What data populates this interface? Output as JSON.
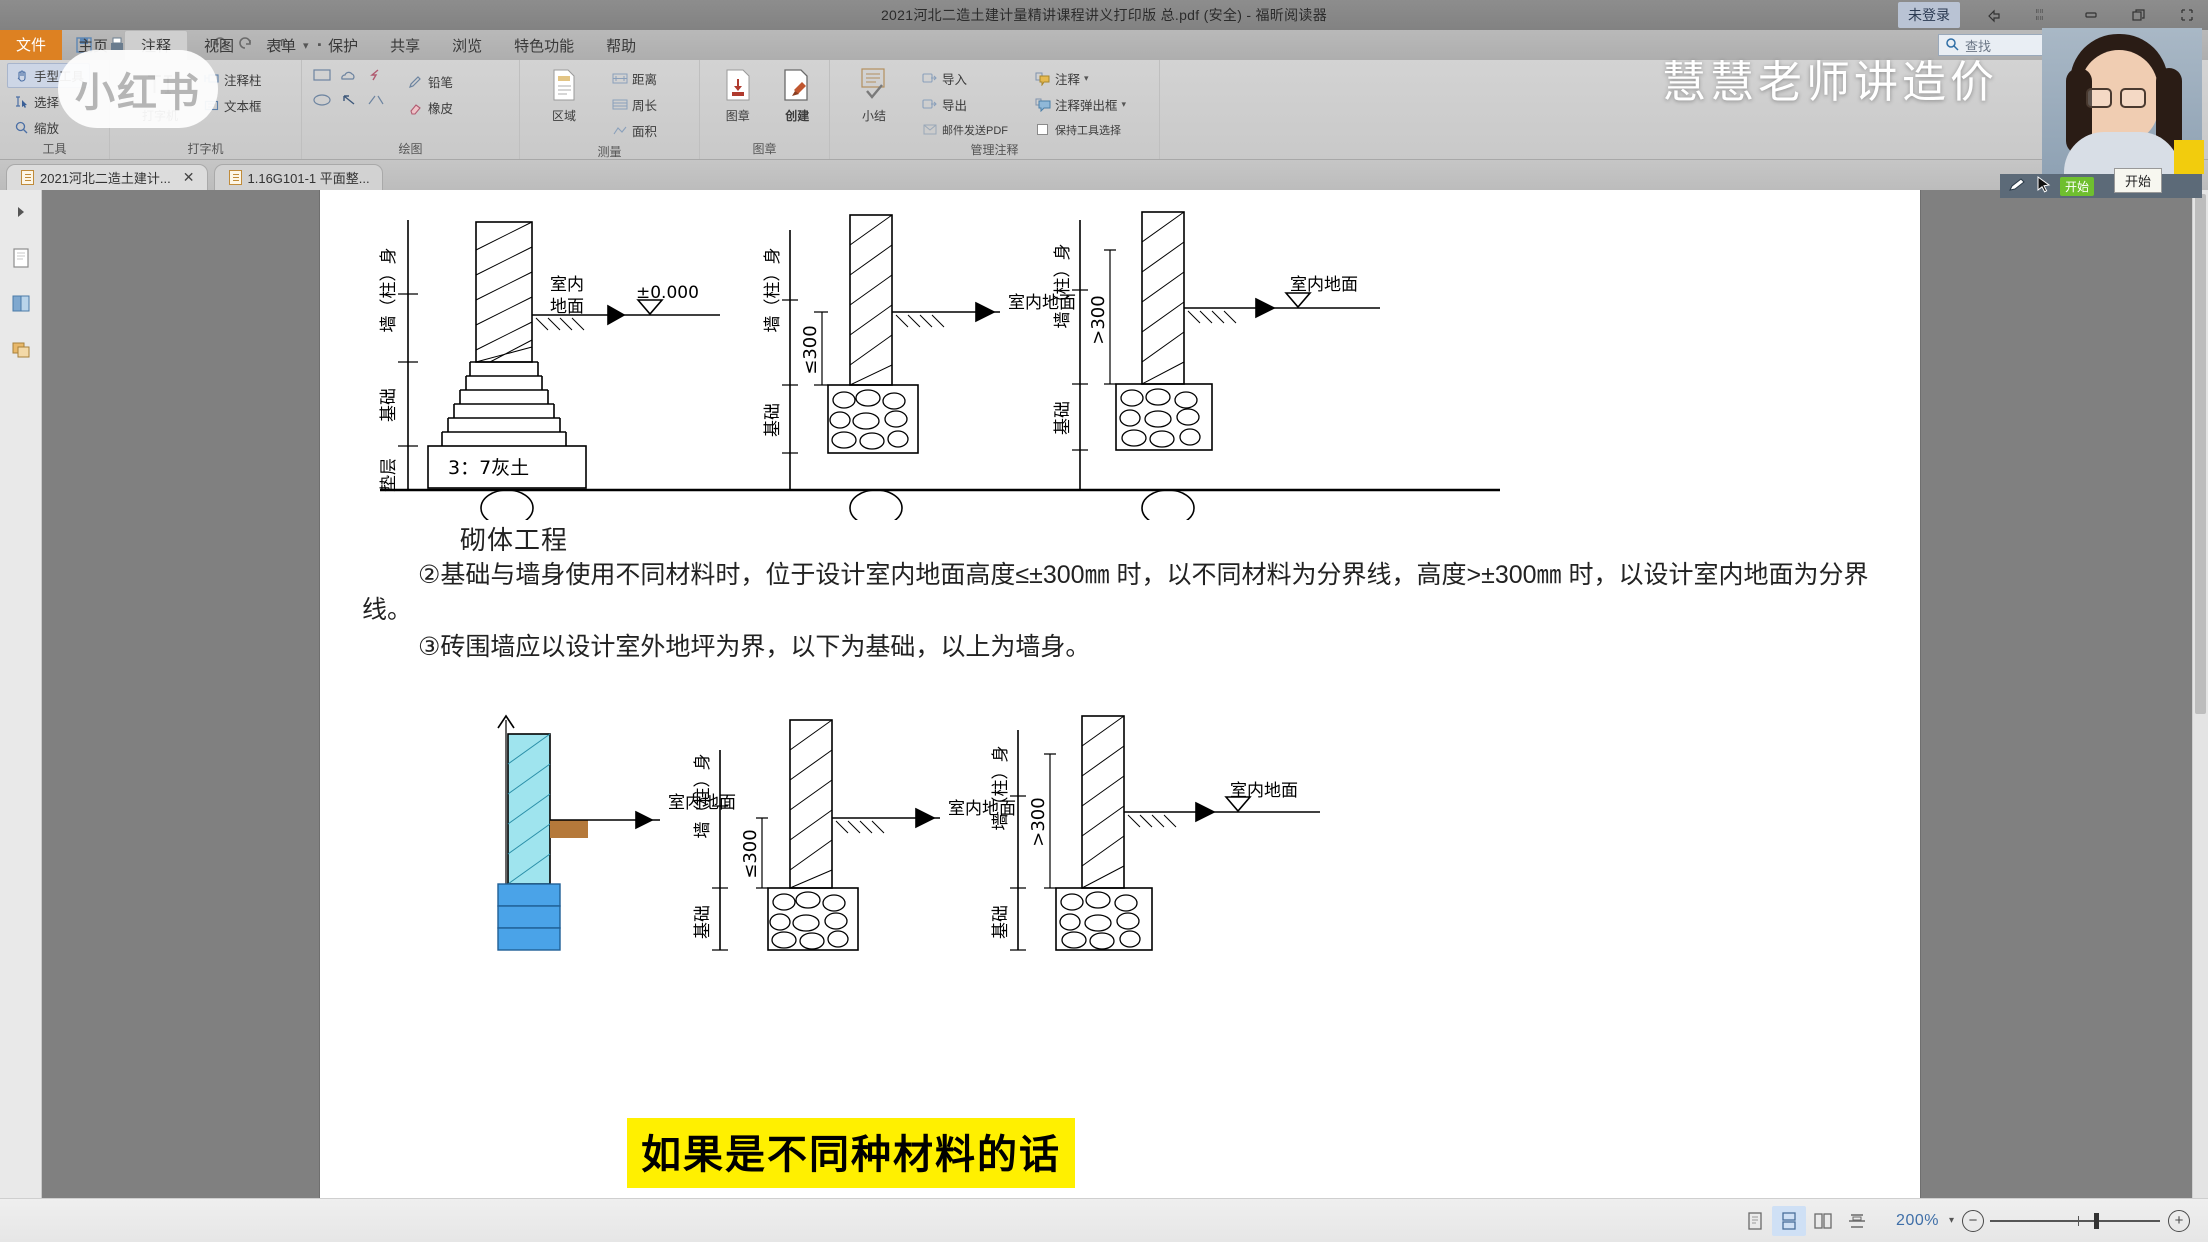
{
  "window": {
    "title": "2021河北二造土建计量精讲课程讲义打印版 总.pdf (安全) - 福昕阅读器",
    "account_label": "未登录",
    "buttons": {
      "share": "share-icon",
      "ribbon_display": "ribbon-options-icon",
      "minimize": "—",
      "restore": "❐",
      "close": "✕"
    }
  },
  "quick_access": {
    "items": [
      "new-document-icon",
      "open-folder-icon",
      "save-icon",
      "print-icon",
      "email-icon",
      "highlight-icon",
      "undo-icon",
      "redo-icon",
      "hand-tool-icon"
    ]
  },
  "search": {
    "placeholder": "查找",
    "icon": "search-icon"
  },
  "ribbon": {
    "file_tab": "文件",
    "tabs": [
      {
        "label": "主页",
        "active": false
      },
      {
        "label": "注释",
        "active": true
      },
      {
        "label": "视图",
        "active": false
      },
      {
        "label": "表单",
        "active": false
      },
      {
        "label": "保护",
        "active": false
      },
      {
        "label": "共享",
        "active": false
      },
      {
        "label": "浏览",
        "active": false
      },
      {
        "label": "特色功能",
        "active": false
      },
      {
        "label": "帮助",
        "active": false
      }
    ],
    "groups": [
      {
        "label": "工具",
        "items": [
          {
            "label": "手型工具",
            "icon": "hand-icon",
            "selected": true
          },
          {
            "label": "选择",
            "icon": "select-text-icon",
            "selected": false
          },
          {
            "label": "缩放",
            "icon": "zoom-icon",
            "selected": false
          }
        ]
      },
      {
        "label": "打字机",
        "items": [
          {
            "label": "打字机",
            "icon": "typewriter-icon"
          },
          {
            "label": "注释柱",
            "icon": "callout-icon"
          },
          {
            "label": "文本框",
            "icon": "textbox-icon"
          }
        ]
      },
      {
        "label": "绘图",
        "shapes": [
          "rectangle-icon",
          "cloud-icon",
          "polyline-icon",
          "ellipse-icon",
          "arrow-icon",
          "line-icon"
        ],
        "items": [
          {
            "label": "铅笔",
            "icon": "pencil-icon"
          },
          {
            "label": "橡皮",
            "icon": "eraser-icon"
          }
        ]
      },
      {
        "label": "测量",
        "items": [
          {
            "label": "区域",
            "icon": "area-measure-icon"
          },
          {
            "label": "距离",
            "icon": "distance-measure-icon"
          },
          {
            "label": "周长",
            "icon": "perimeter-measure-icon"
          },
          {
            "label": "面积",
            "icon": "surface-measure-icon"
          }
        ]
      },
      {
        "label": "图章",
        "items": [
          {
            "label": "图章",
            "icon": "stamp-icon"
          },
          {
            "label": "创建",
            "icon": "create-stamp-icon"
          }
        ]
      },
      {
        "label": "管理注释",
        "items": [
          {
            "label": "小结",
            "icon": "summary-icon"
          },
          {
            "label": "导入",
            "icon": "import-icon"
          },
          {
            "label": "导出",
            "icon": "export-icon"
          },
          {
            "label": "邮件发送PDF",
            "icon": "mail-pdf-icon"
          },
          {
            "label": "注释",
            "icon": "comment-icon"
          },
          {
            "label": "注释弹出框",
            "icon": "comment-popup-icon"
          },
          {
            "label": "保持工具选择",
            "icon": "keep-tool-icon"
          }
        ]
      }
    ]
  },
  "doc_tabs": [
    {
      "label": "2021河北二造土建计...",
      "active": true,
      "closable": true
    },
    {
      "label": "1.16G101-1 平面整...",
      "active": false,
      "closable": false
    }
  ],
  "left_rail": {
    "items": [
      "expand-panel-icon",
      "page-thumbnails-icon",
      "bookmarks-icon",
      "layers-icon"
    ]
  },
  "document": {
    "heading": "砌体工程",
    "paragraph_1": "②基础与墙身使用不同材料时，位于设计室内地面高度≤±300㎜ 时，以不同材料为分界线，高度>±300㎜ 时，以设计室内地面为分界线。",
    "paragraph_2": "③砖围墙应以设计室外地坪为界，以下为基础，以上为墙身。",
    "figure_labels": {
      "wall_body": "墙（柱）身",
      "foundation": "基础",
      "cushion": "垫层",
      "indoor_floor": "室内地面",
      "indoor_floor_2line": "室内\n地面",
      "elevation": "±0.000",
      "lime_soil": "3：7灰土",
      "le300": "≤300",
      "gt300": ">300"
    }
  },
  "subtitle": {
    "text": "如果是不同种材料的话",
    "background": "#fff000",
    "color": "#000000"
  },
  "overlays": {
    "watermark": "小红书",
    "brand": "慧慧老师讲造价",
    "tooltip": "开始",
    "camera_label": "presenter-camera"
  },
  "statusbar": {
    "view_modes": [
      "single-page-icon",
      "continuous-scroll-icon",
      "two-page-icon",
      "split-view-icon"
    ],
    "active_view_mode": 1,
    "zoom_level": "200%",
    "zoom_out": "−",
    "zoom_in": "+"
  },
  "colors": {
    "accent_orange": "#dd8122",
    "subtitle_yellow": "#fff000",
    "zoom_blue": "#3f6fa8",
    "ribbon_gray": "#cfcfcf",
    "page_bg_gray": "#808080"
  }
}
